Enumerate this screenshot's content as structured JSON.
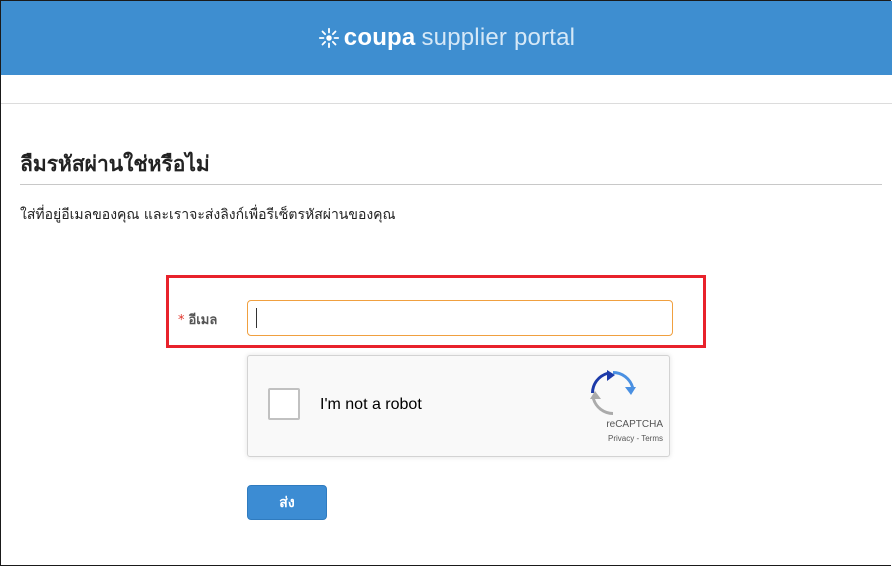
{
  "header": {
    "brand_bold": "coupa",
    "brand_light": "supplier portal",
    "bar_color": "#3e8ed0"
  },
  "page": {
    "title": "ลืมรหัสผ่านใช่หรือไม่",
    "instructions": "ใส่ที่อยู่อีเมลของคุณ และเราจะส่งลิงก์เพื่อรีเซ็ตรหัสผ่านของคุณ"
  },
  "form": {
    "required_marker": "*",
    "email_label": "อีเมล",
    "email_value": "",
    "submit_label": "ส่ง",
    "highlight_color": "#e8222b"
  },
  "recaptcha": {
    "label": "I'm not a robot",
    "brand": "reCAPTCHA",
    "privacy": "Privacy",
    "separator": " - ",
    "terms": "Terms",
    "icon": "recaptcha-logo-icon"
  }
}
